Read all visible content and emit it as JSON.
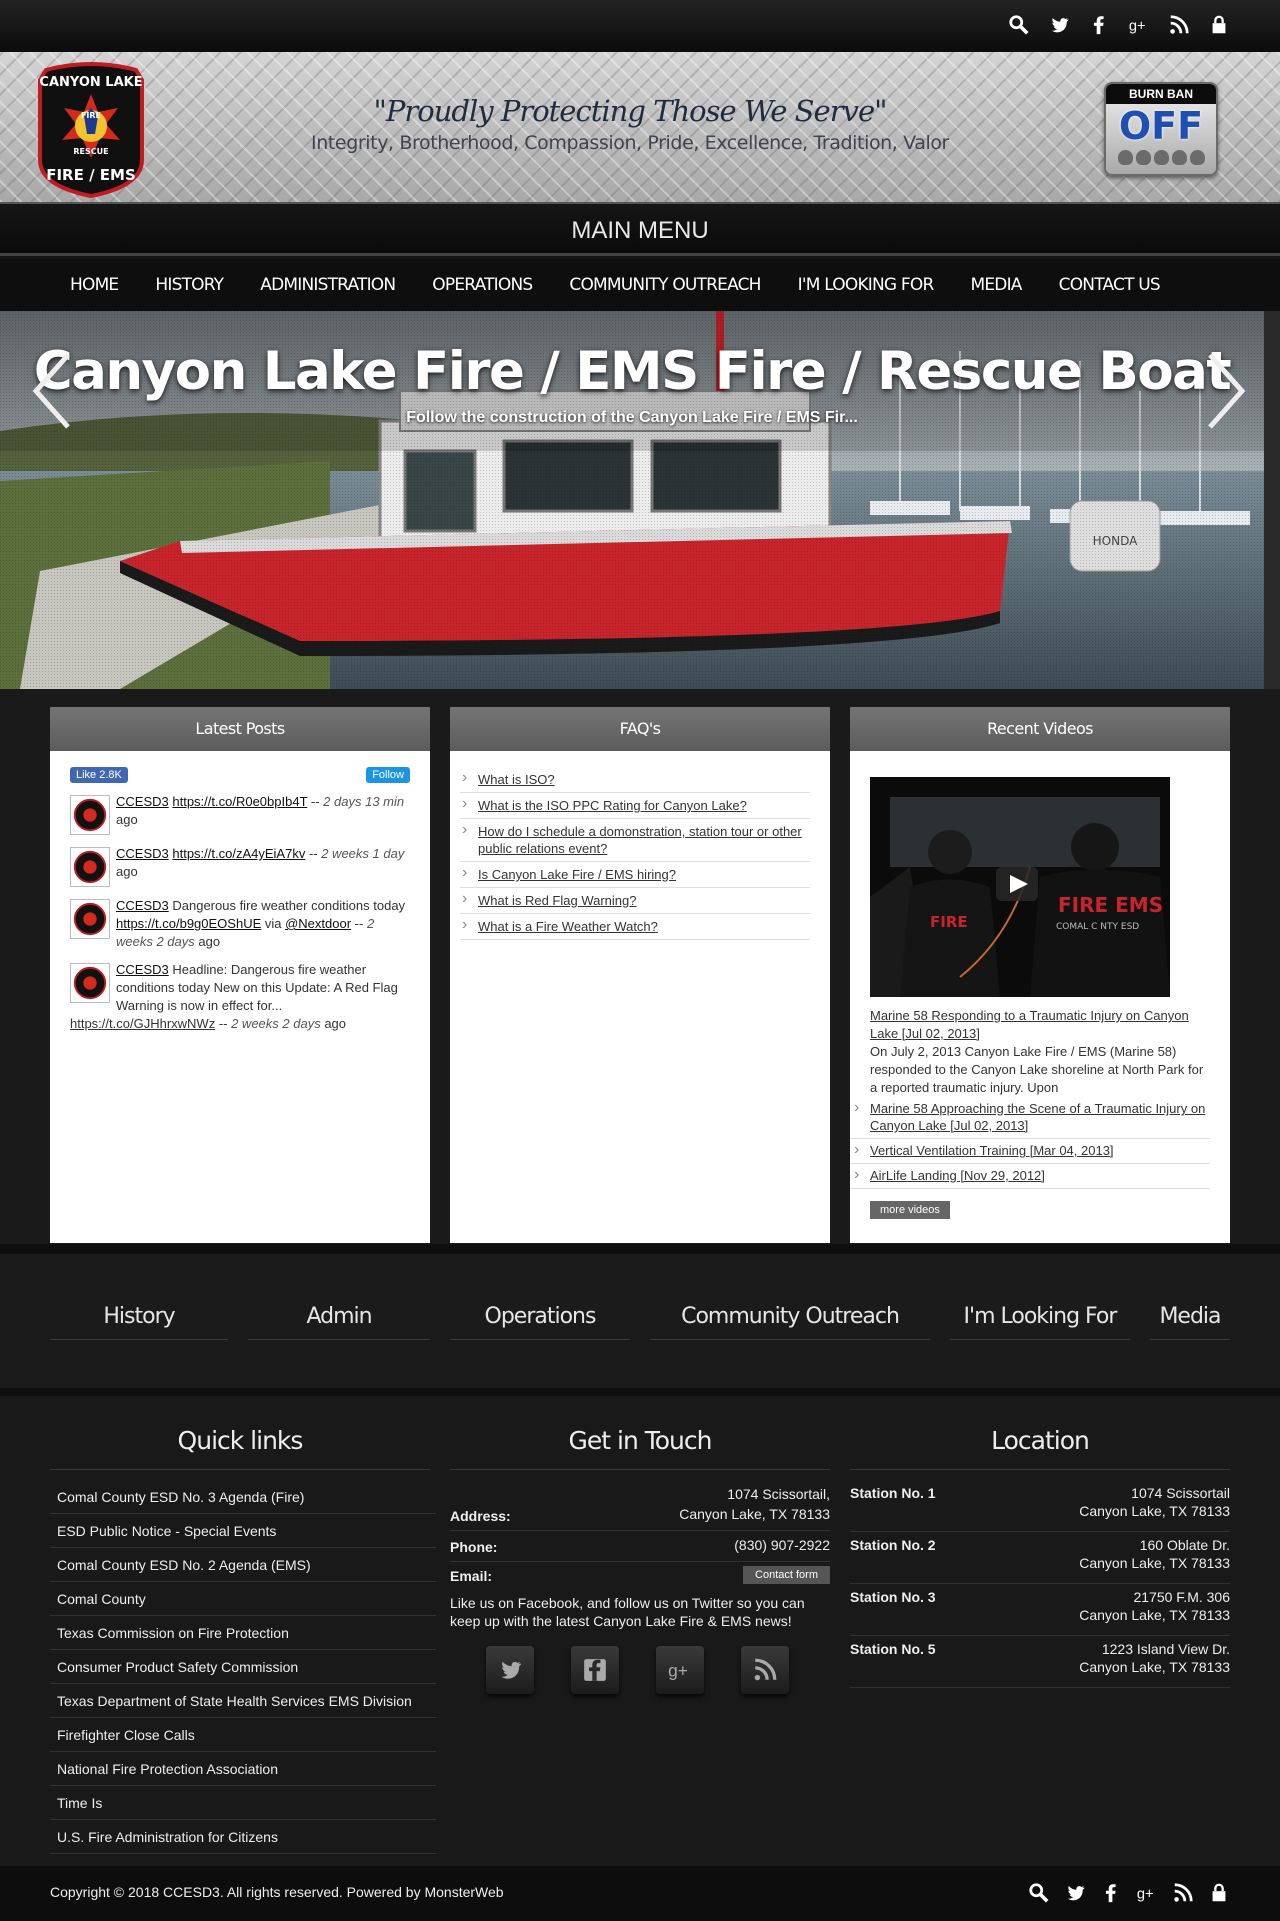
{
  "topbar": {
    "icons": [
      "search-icon",
      "twitter-icon",
      "facebook-icon",
      "google-plus-icon",
      "rss-icon",
      "lock-icon"
    ]
  },
  "header": {
    "logo_line1": "CANYON LAKE",
    "logo_line2": "FIRE / EMS",
    "logo_fire": "FIRE",
    "logo_rescue": "RESCUE",
    "motto": "\"Proudly Protecting Those We Serve\"",
    "values": "Integrity, Brotherhood, Compassion, Pride, Excellence, Tradition, Valor",
    "burn_ban_label": "BURN BAN",
    "burn_ban_status": "OFF"
  },
  "menu": {
    "title": "MAIN MENU",
    "items": [
      "HOME",
      "HISTORY",
      "ADMINISTRATION",
      "OPERATIONS",
      "COMMUNITY OUTREACH",
      "I'M LOOKING FOR",
      "MEDIA",
      "CONTACT US"
    ]
  },
  "slider": {
    "title": "Canyon Lake Fire / EMS Fire / Rescue Boat",
    "subtitle": "Follow the construction of the Canyon Lake Fire / EMS Fir..."
  },
  "latest_posts": {
    "title": "Latest Posts",
    "fb_like": "Like 2.8K",
    "tw_follow": "Follow",
    "tweets": [
      {
        "user": "CCESD3",
        "text": "",
        "link": "https://t.co/R0e0bpIb4T",
        "after": "",
        "via": "",
        "sep": " -- ",
        "time": "2 days 13 min",
        "ago": " ago"
      },
      {
        "user": "CCESD3",
        "text": "",
        "link": "https://t.co/zA4yEiA7kv",
        "after": "",
        "via": "",
        "sep": " -- ",
        "time": "2 weeks 1 day",
        "ago": " ago"
      },
      {
        "user": "CCESD3",
        "text": " Dangerous fire weather conditions today ",
        "link": "https://t.co/b9g0EOShUE",
        "after": " via ",
        "via": "@Nextdoor",
        "sep": " -- ",
        "time": "2 weeks 2 days",
        "ago": " ago"
      },
      {
        "user": "CCESD3",
        "text": " Headline: Dangerous fire weather conditions today New on this Update: A Red Flag Warning is now in effect for...",
        "link": "",
        "after": "",
        "via": "",
        "sep": "",
        "time": "",
        "ago": ""
      }
    ],
    "tail_link": "https://t.co/GJHhrxwNWz",
    "tail_sep": " -- ",
    "tail_time": "2 weeks 2 days",
    "tail_ago": " ago"
  },
  "faqs": {
    "title": "FAQ's",
    "items": [
      "What is ISO?",
      "What is the ISO PPC Rating for Canyon Lake?",
      "How do I schedule a domonstration, station tour or other public relations event?",
      "Is Canyon Lake Fire / EMS hiring?",
      "What is Red Flag Warning?",
      "What is a Fire Weather Watch?"
    ]
  },
  "videos": {
    "title": "Recent Videos",
    "featured_title": "Marine 58 Responding to a Traumatic Injury on Canyon Lake [Jul 02, 2013]",
    "featured_desc": "On July 2, 2013 Canyon Lake Fire / EMS (Marine 58) responded to the Canyon Lake shoreline at North Park for a reported traumatic injury. Upon",
    "shirt_text": "FIRE EMS",
    "shirt_sub": "COMAL C    NTY ESD",
    "items": [
      "Marine 58 Approaching the Scene of a Traumatic Injury on Canyon Lake [Jul 02, 2013]",
      "Vertical Ventilation Training [Mar 04, 2013]",
      "AirLife Landing [Nov 29, 2012]"
    ],
    "more": "more videos"
  },
  "quicknav": [
    "History",
    "Admin",
    "Operations",
    "Community Outreach",
    "I'm Looking For",
    "Media"
  ],
  "footer": {
    "quick_links_title": "Quick links",
    "quick_links": [
      "Comal County ESD No. 3 Agenda (Fire)",
      "ESD Public Notice - Special Events",
      "Comal County ESD No. 2 Agenda (EMS)",
      "Comal County",
      "Texas Commission on Fire Protection",
      "Consumer Product Safety Commission",
      "Texas Department of State Health Services EMS Division",
      "Firefighter Close Calls",
      "National Fire Protection Association",
      "Time Is",
      "U.S. Fire Administration for Citizens"
    ],
    "get_in_touch_title": "Get in Touch",
    "address_label": "Address:",
    "address_line1": "1074 Scissortail,",
    "address_line2": "Canyon Lake, TX 78133",
    "phone_label": "Phone:",
    "phone": "(830) 907-2922",
    "email_label": "Email:",
    "contact_button": "Contact form",
    "social_msg": "Like us on Facebook, and follow us on Twitter so you can keep up with the latest Canyon Lake Fire & EMS news!",
    "location_title": "Location",
    "stations": [
      {
        "name": "Station No. 1",
        "line1": "1074 Scissortail",
        "line2": "Canyon Lake, TX 78133"
      },
      {
        "name": "Station No. 2",
        "line1": "160 Oblate Dr.",
        "line2": "Canyon Lake, TX 78133"
      },
      {
        "name": "Station No. 3",
        "line1": "21750 F.M. 306",
        "line2": "Canyon Lake, TX 78133"
      },
      {
        "name": "Station No. 5",
        "line1": "1223 Island View Dr.",
        "line2": "Canyon Lake, TX 78133"
      }
    ],
    "copyright": "Copyright © 2018 CCESD3. All rights reserved. Powered by MonsterWeb"
  },
  "colors": {
    "accent_blue": "#1f4fb0",
    "boat_red": "#c8242b",
    "panel_head": "#666666"
  }
}
